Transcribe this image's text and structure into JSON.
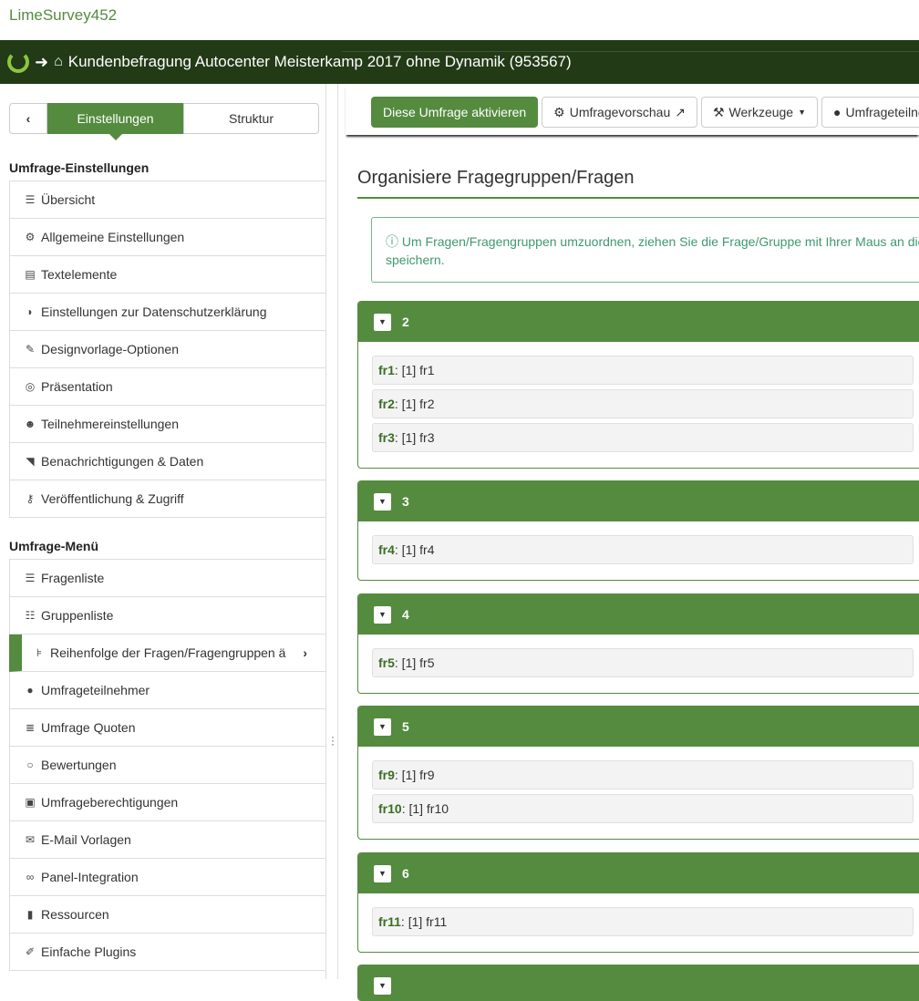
{
  "brand": "LimeSurvey452",
  "header": {
    "title": "Kundenbefragung Autocenter Meisterkamp 2017 ohne Dynamik (953567)"
  },
  "sidebar": {
    "tabs": [
      "Einstellungen",
      "Struktur"
    ],
    "section1": "Umfrage-Einstellungen",
    "settings": [
      {
        "icon": "list-icon",
        "g": "☰",
        "label": "Übersicht"
      },
      {
        "icon": "cogs-icon",
        "g": "⚙",
        "label": "Allgemeine Einstellungen"
      },
      {
        "icon": "file-text-icon",
        "g": "▤",
        "label": "Textelemente"
      },
      {
        "icon": "shield-icon",
        "g": "◗",
        "label": "Einstellungen zur Datenschutzerklärung"
      },
      {
        "icon": "paint-brush-icon",
        "g": "✎",
        "label": "Designvorlage-Optionen"
      },
      {
        "icon": "eye-slash-icon",
        "g": "◎",
        "label": "Präsentation"
      },
      {
        "icon": "users-icon",
        "g": "☻",
        "label": "Teilnehmereinstellungen"
      },
      {
        "icon": "rss-icon",
        "g": "◥",
        "label": "Benachrichtigungen & Daten"
      },
      {
        "icon": "key-icon",
        "g": "⚷",
        "label": "Veröffentlichung & Zugriff"
      }
    ],
    "section2": "Umfrage-Menü",
    "menu": [
      {
        "icon": "list-icon",
        "g": "☰",
        "label": "Fragenliste"
      },
      {
        "icon": "th-list-icon",
        "g": "☷",
        "label": "Gruppenliste"
      },
      {
        "icon": "sitemap-icon",
        "g": "⊧",
        "label": "Reihenfolge der Fragen/Fragengruppen ä",
        "active": true
      },
      {
        "icon": "user-icon",
        "g": "●",
        "label": "Umfrageteilnehmer"
      },
      {
        "icon": "tasks-icon",
        "g": "≣",
        "label": "Umfrage Quoten"
      },
      {
        "icon": "comment-icon",
        "g": "○",
        "label": "Bewertungen"
      },
      {
        "icon": "lock-icon",
        "g": "▣",
        "label": "Umfrageberechtigungen"
      },
      {
        "icon": "envelope-icon",
        "g": "✉",
        "label": "E-Mail Vorlagen"
      },
      {
        "icon": "link-icon",
        "g": "∞",
        "label": "Panel-Integration"
      },
      {
        "icon": "file-icon",
        "g": "▮",
        "label": "Ressourcen"
      },
      {
        "icon": "plug-icon",
        "g": "✐",
        "label": "Einfache Plugins"
      }
    ]
  },
  "toolbar": {
    "activate": "Diese Umfrage aktivieren",
    "preview": "Umfragevorschau",
    "tools": "Werkzeuge",
    "participants": "Umfrageteilnehmer"
  },
  "main": {
    "title": "Organisiere Fragegruppen/Fragen",
    "alert_line1": "Um Fragen/Fragengruppen umzuordnen, ziehen Sie die Frage/Gruppe mit Ihrer Maus an die gewünschte Position",
    "alert_line2": "speichern.",
    "groups": [
      {
        "name": "2",
        "questions": [
          {
            "code": "fr1",
            "text": ": [1] fr1"
          },
          {
            "code": "fr2",
            "text": ": [1] fr2"
          },
          {
            "code": "fr3",
            "text": ": [1] fr3"
          }
        ]
      },
      {
        "name": "3",
        "questions": [
          {
            "code": "fr4",
            "text": ": [1] fr4"
          }
        ]
      },
      {
        "name": "4",
        "questions": [
          {
            "code": "fr5",
            "text": ": [1] fr5"
          }
        ]
      },
      {
        "name": "5",
        "questions": [
          {
            "code": "fr9",
            "text": ": [1] fr9"
          },
          {
            "code": "fr10",
            "text": ": [1] fr10"
          }
        ]
      },
      {
        "name": "6",
        "questions": [
          {
            "code": "fr11",
            "text": ": [1] fr11"
          }
        ]
      }
    ]
  }
}
